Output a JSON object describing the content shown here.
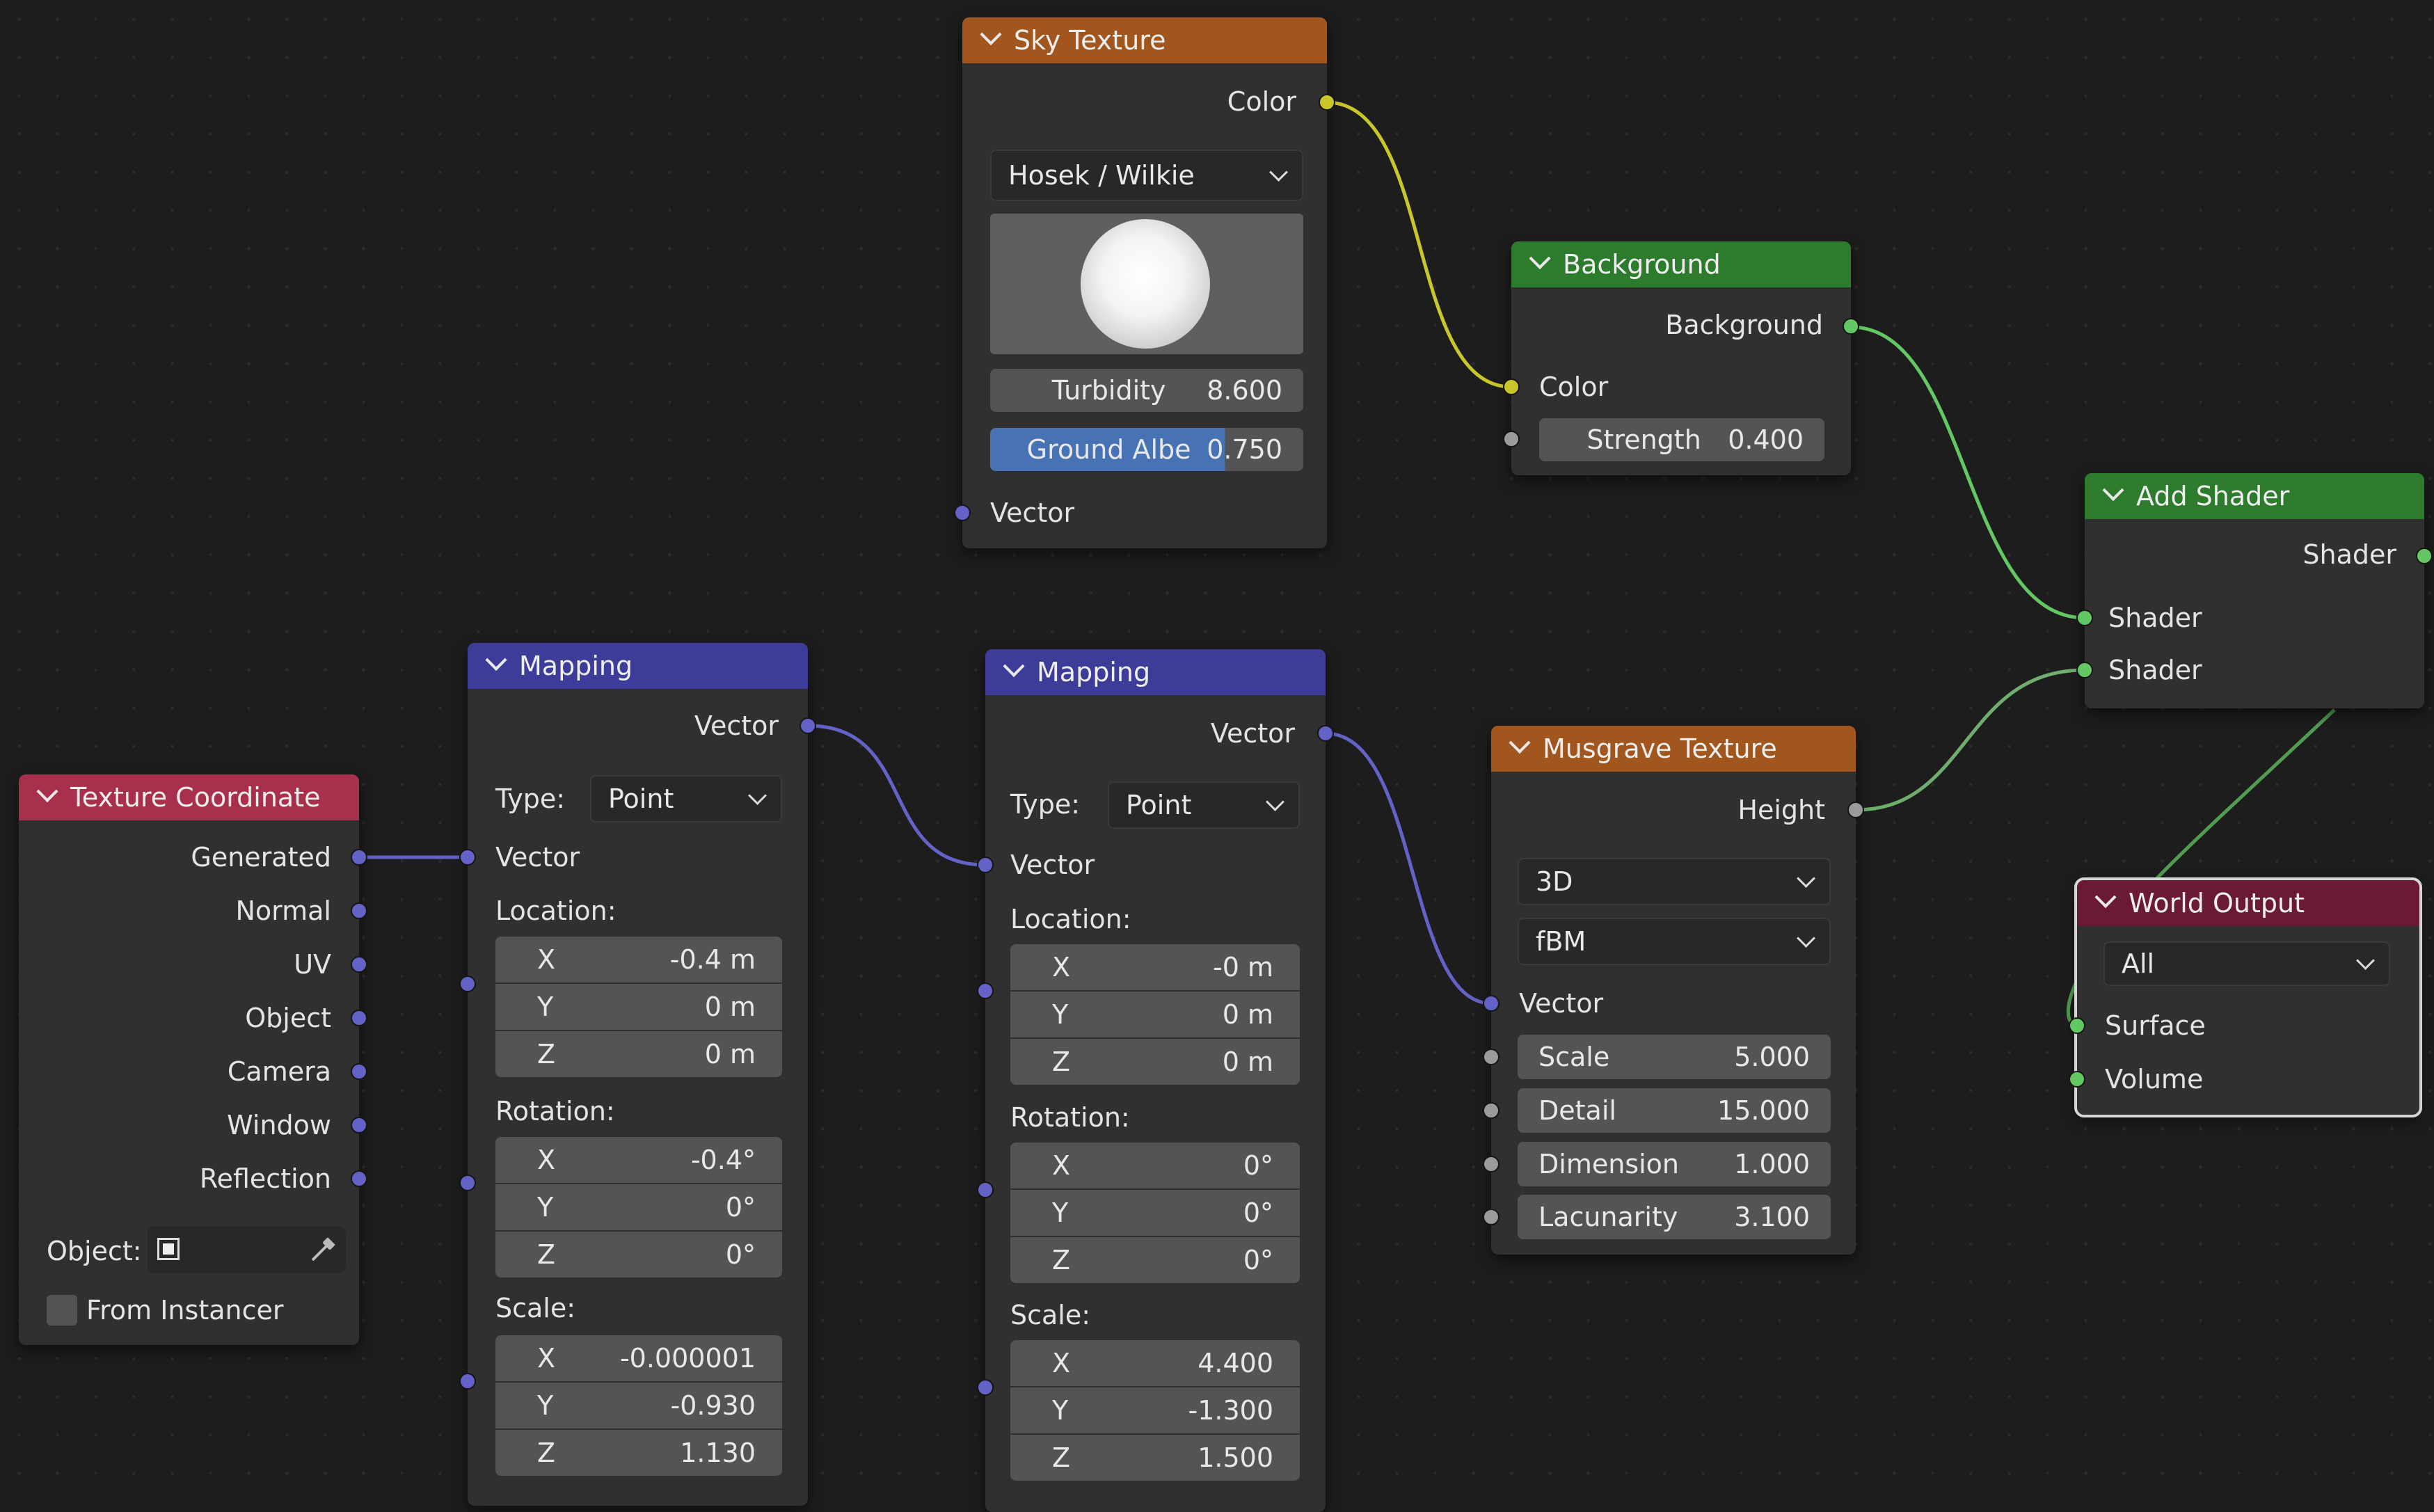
{
  "sky": {
    "title": "Sky Texture",
    "out_color": "Color",
    "sky_type": "Hosek / Wilkie",
    "turbidity_label": "Turbidity",
    "turbidity": "8.600",
    "ground_label": "Ground Albe",
    "ground": "0.750",
    "ground_fraction": 0.75,
    "in_vector": "Vector"
  },
  "background": {
    "title": "Background",
    "out_background": "Background",
    "in_color": "Color",
    "strength_label": "Strength",
    "strength": "0.400"
  },
  "add_shader": {
    "title": "Add Shader",
    "out_shader": "Shader",
    "in_shader1": "Shader",
    "in_shader2": "Shader"
  },
  "musgrave": {
    "title": "Musgrave Texture",
    "out_height": "Height",
    "dimensions": "3D",
    "type": "fBM",
    "in_vector": "Vector",
    "scale_label": "Scale",
    "scale": "5.000",
    "detail_label": "Detail",
    "detail": "15.000",
    "dimension_label": "Dimension",
    "dimension": "1.000",
    "lacunarity_label": "Lacunarity",
    "lacunarity": "3.100"
  },
  "world_output": {
    "title": "World Output",
    "target": "All",
    "in_surface": "Surface",
    "in_volume": "Volume"
  },
  "texcoord": {
    "title": "Texture Coordinate",
    "outputs": [
      "Generated",
      "Normal",
      "UV",
      "Object",
      "Camera",
      "Window",
      "Reflection"
    ],
    "object_label": "Object:",
    "from_instancer": "From Instancer"
  },
  "mapping1": {
    "title": "Mapping",
    "out_vector": "Vector",
    "type_label": "Type:",
    "type": "Point",
    "in_vector": "Vector",
    "location_label": "Location:",
    "rotation_label": "Rotation:",
    "scale_label": "Scale:",
    "axes": [
      "X",
      "Y",
      "Z"
    ],
    "location": [
      "-0.4 m",
      "0 m",
      "0 m"
    ],
    "rotation": [
      "-0.4°",
      "0°",
      "0°"
    ],
    "scale": [
      "-0.000001",
      "-0.930",
      "1.130"
    ]
  },
  "mapping2": {
    "title": "Mapping",
    "out_vector": "Vector",
    "type_label": "Type:",
    "type": "Point",
    "in_vector": "Vector",
    "location_label": "Location:",
    "rotation_label": "Rotation:",
    "scale_label": "Scale:",
    "axes": [
      "X",
      "Y",
      "Z"
    ],
    "location": [
      "-0 m",
      "0 m",
      "0 m"
    ],
    "rotation": [
      "0°",
      "0°",
      "0°"
    ],
    "scale": [
      "4.400",
      "-1.300",
      "1.500"
    ]
  },
  "colors": {
    "texture_header": "#a0561c",
    "shader_header": "#2d7b2d",
    "vector_header": "#3d3d99",
    "input_header": "#a8304d",
    "output_header": "#6a1a33",
    "vector_socket": "#6363c7",
    "color_socket": "#c7c729",
    "shader_socket": "#63c763",
    "float_socket": "#9b9b9b",
    "slider_fill": "#4772b3"
  }
}
